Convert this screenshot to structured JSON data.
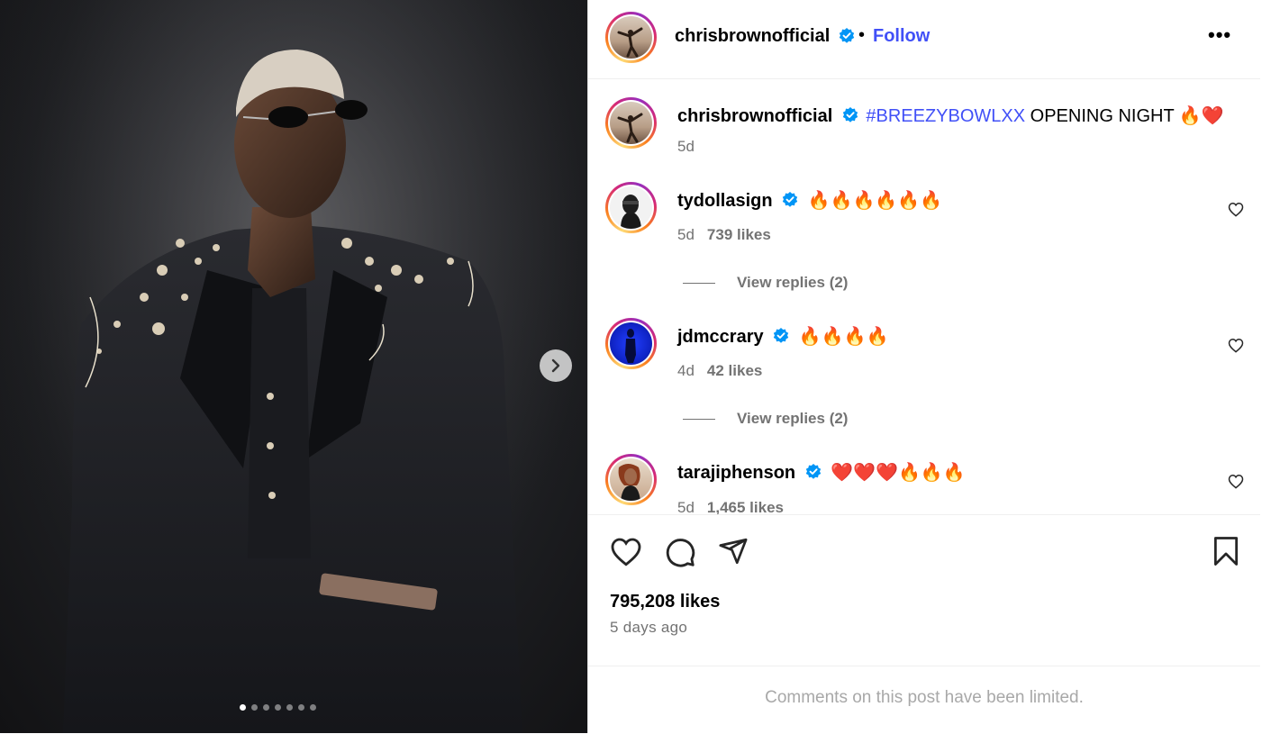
{
  "post": {
    "author": "chrisbrownofficial",
    "follow_label": "Follow",
    "more_label": "•••",
    "separator": "•",
    "carousel": {
      "count": 7,
      "active_index": 0
    }
  },
  "caption": {
    "username": "chrisbrownofficial",
    "hashtag": "#BREEZYBOWLXX",
    "text": " OPENING NIGHT ",
    "emojis": "🔥❤️",
    "time": "5d"
  },
  "comments": [
    {
      "username": "tydollasign",
      "text": "🔥🔥🔥🔥🔥🔥",
      "time": "5d",
      "likes": "739 likes",
      "replies": "View replies (2)"
    },
    {
      "username": "jdmccrary",
      "text": "🔥🔥🔥🔥",
      "time": "4d",
      "likes": "42 likes",
      "replies": "View replies (2)"
    },
    {
      "username": "tarajiphenson",
      "text": "❤️❤️❤️🔥🔥🔥",
      "time": "5d",
      "likes": "1,465 likes"
    }
  ],
  "stats": {
    "likes": "795,208 likes",
    "ago": "5 days ago"
  },
  "footer": {
    "limited": "Comments on this post have been limited."
  },
  "colors": {
    "link_blue": "#4150f7",
    "verified_blue": "#0095f6",
    "muted": "#737373"
  },
  "icons": [
    "chevron-right-icon",
    "verified-badge-icon",
    "heart-icon",
    "comment-icon",
    "share-icon",
    "bookmark-icon"
  ]
}
